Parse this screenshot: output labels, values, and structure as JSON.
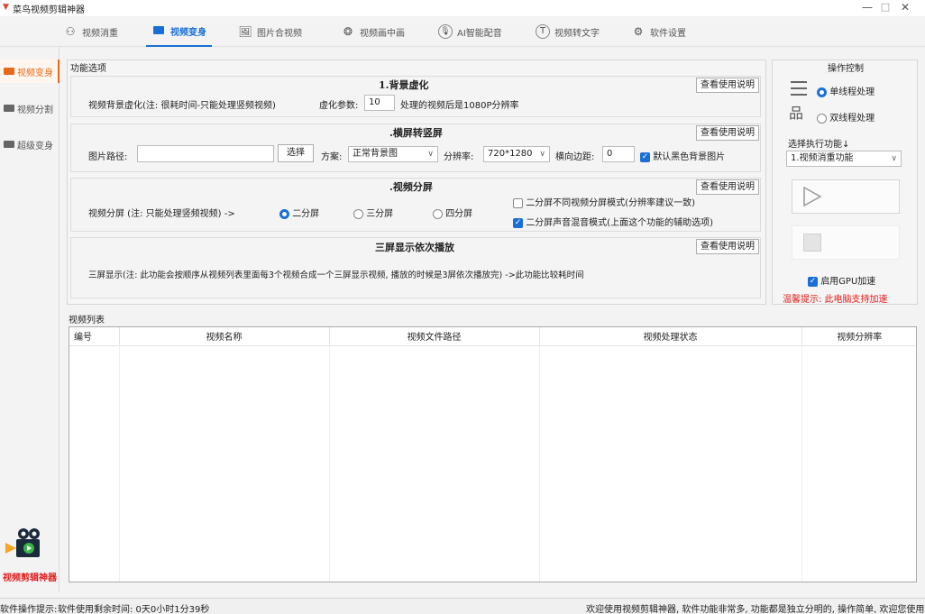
{
  "window": {
    "title": "菜鸟视频剪辑神器",
    "minimize": "—",
    "maximize": "□",
    "close": "✕"
  },
  "nav": {
    "tabs": [
      {
        "label": "视频消重",
        "icon": "people-icon"
      },
      {
        "label": "视频变身",
        "icon": "video-camera-icon"
      },
      {
        "label": "图片合视频",
        "icon": "image-icon"
      },
      {
        "label": "视频画中画",
        "icon": "film-reel-icon"
      },
      {
        "label": "AI智能配音",
        "icon": "microphone-icon"
      },
      {
        "label": "视频转文字",
        "icon": "text-t-icon"
      },
      {
        "label": "软件设置",
        "icon": "gear-icon"
      }
    ],
    "active": 1
  },
  "sidebar": {
    "items": [
      {
        "label": "视频变身",
        "active": true
      },
      {
        "label": "视频分割",
        "active": false
      },
      {
        "label": "超级变身",
        "active": false
      }
    ],
    "brand": "视频剪辑神器"
  },
  "options": {
    "group_title": "功能选项",
    "help_label": "查看使用说明",
    "s1": {
      "title": "1.背景虚化",
      "desc": "视频背景虚化(注: 很耗时间-只能处理竖频视频)",
      "param_label": "虚化参数:",
      "param_value": "10",
      "note": "处理的视频后是1080P分辨率"
    },
    "s2": {
      "title": ".横屏转竖屏",
      "path_label": "图片路径:",
      "path_value": "",
      "choose_label": "选择",
      "scheme_label": "方案:",
      "scheme_value": "正常背景图",
      "res_label": "分辨率:",
      "res_value": "720*1280",
      "margin_label": "横向边距:",
      "margin_value": "0",
      "black_bg_label": "默认黑色背景图片",
      "black_bg_checked": true
    },
    "s3": {
      "title": ".视频分屏",
      "desc": "视频分屏 (注: 只能处理竖频视频) ->",
      "radios": [
        "二分屏",
        "三分屏",
        "四分屏"
      ],
      "selected": 0,
      "cb1_label": "二分屏不同视频分屏模式(分辨率建议一致)",
      "cb1_checked": false,
      "cb2_label": "二分屏声音混音模式(上面这个功能的辅助选项)",
      "cb2_checked": true
    },
    "s4": {
      "title": "三屏显示依次播放",
      "desc": "三屏显示(注: 此功能会按顺序从视频列表里面每3个视频合成一个三屏显示视频, 播放的时候是3屏依次播放完) ->此功能比较耗时间"
    }
  },
  "control": {
    "title": "操作控制",
    "single_label": "单线程处理",
    "multi_label": "双线程处理",
    "single_selected": true,
    "exec_label": "选择执行功能↓",
    "exec_value": "1.视频消重功能",
    "gpu_label": "启用GPU加速",
    "gpu_checked": true,
    "tip": "温馨提示: 此电脑支持加速"
  },
  "list": {
    "title": "视频列表",
    "columns": [
      "编号",
      "视频名称",
      "视频文件路径",
      "视频处理状态",
      "视频分辨率"
    ]
  },
  "status": {
    "left": "软件操作提示:",
    "remaining": "软件使用剩余时间: 0天0小时1分39秒",
    "welcome": "欢迎使用视频剪辑神器, 软件功能非常多, 功能都是独立分明的, 操作简单, 欢迎您使用"
  },
  "colors": {
    "accent": "#1a6fd6",
    "orange": "#e8681a",
    "warning": "#e02020"
  }
}
